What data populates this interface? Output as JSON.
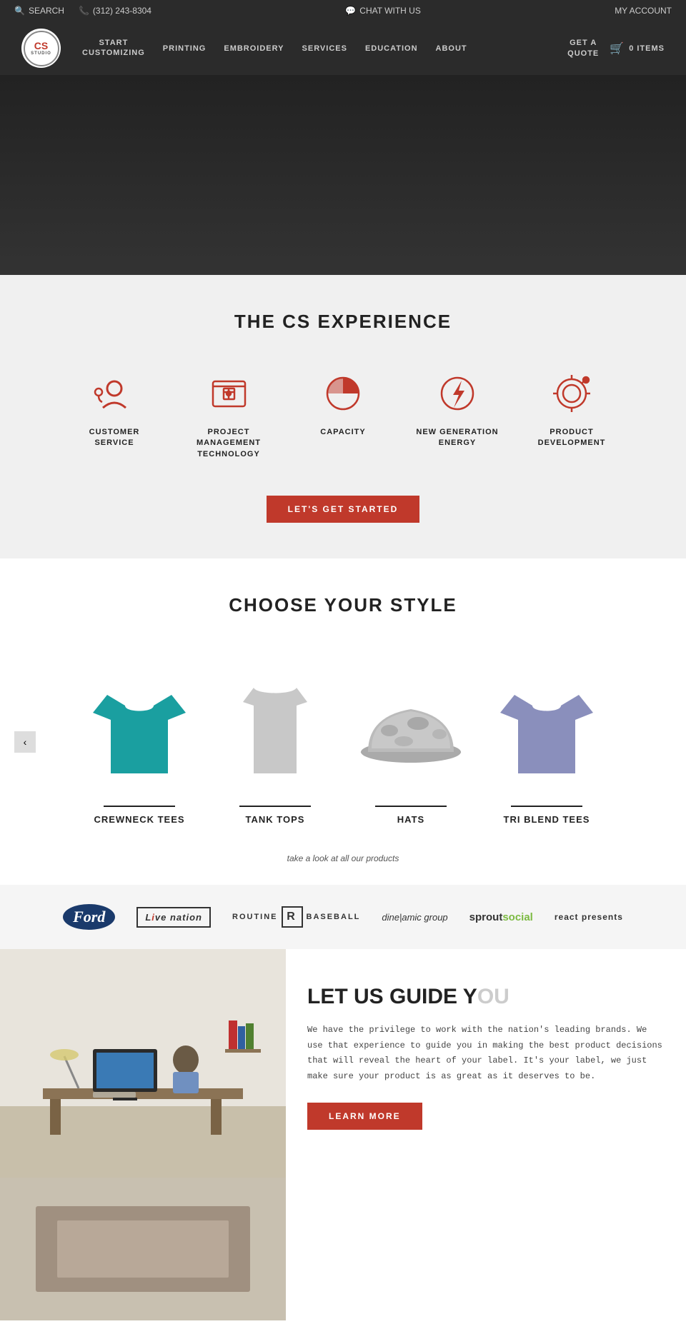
{
  "header": {
    "search_label": "SEARCH",
    "phone": "(312) 243-8304",
    "chat_label": "CHAT WITH US",
    "account_label": "MY ACCOUNT",
    "nav_items": [
      {
        "label": "START CUSTOMIZING",
        "href": "#"
      },
      {
        "label": "PRINTING",
        "href": "#"
      },
      {
        "label": "EMBROIDERY",
        "href": "#"
      },
      {
        "label": "SERVICES",
        "href": "#"
      },
      {
        "label": "EDUCATION",
        "href": "#"
      },
      {
        "label": "ABOUT",
        "href": "#"
      }
    ],
    "get_quote_label": "GET A QUOTE",
    "cart_label": "0 ITEMS"
  },
  "experience": {
    "section_title": "THE CS EXPERIENCE",
    "items": [
      {
        "label": "CUSTOMER SERVICE"
      },
      {
        "label": "PROJECT MANAGEMENT TECHNOLOGY"
      },
      {
        "label": "CAPACITY"
      },
      {
        "label": "NEW GENERATION ENERGY"
      },
      {
        "label": "PRODUCT DEVELOPMENT"
      }
    ],
    "cta_label": "LET'S GET STARTED"
  },
  "style": {
    "section_title": "CHOOSE YOUR STYLE",
    "products": [
      {
        "label": "CREWNECK TEES"
      },
      {
        "label": "TANK TOPS"
      },
      {
        "label": "HATS"
      },
      {
        "label": "TRI BLEND TEES"
      }
    ],
    "view_all": "take a look at all our products"
  },
  "brands": {
    "logos": [
      {
        "name": "Ford"
      },
      {
        "name": "Live Nation"
      },
      {
        "name": "Routine Baseball"
      },
      {
        "name": "dine|amic group"
      },
      {
        "name": "sproutsocial"
      },
      {
        "name": "react presents"
      }
    ]
  },
  "guide": {
    "title": "LET US GUIDE YOU",
    "body": "We have the privilege to work with the nation's leading brands. We use that experience to guide you in making the best product decisions that will reveal the heart of your label. It's your label, we just make sure your product is as great as it deserves to be."
  }
}
